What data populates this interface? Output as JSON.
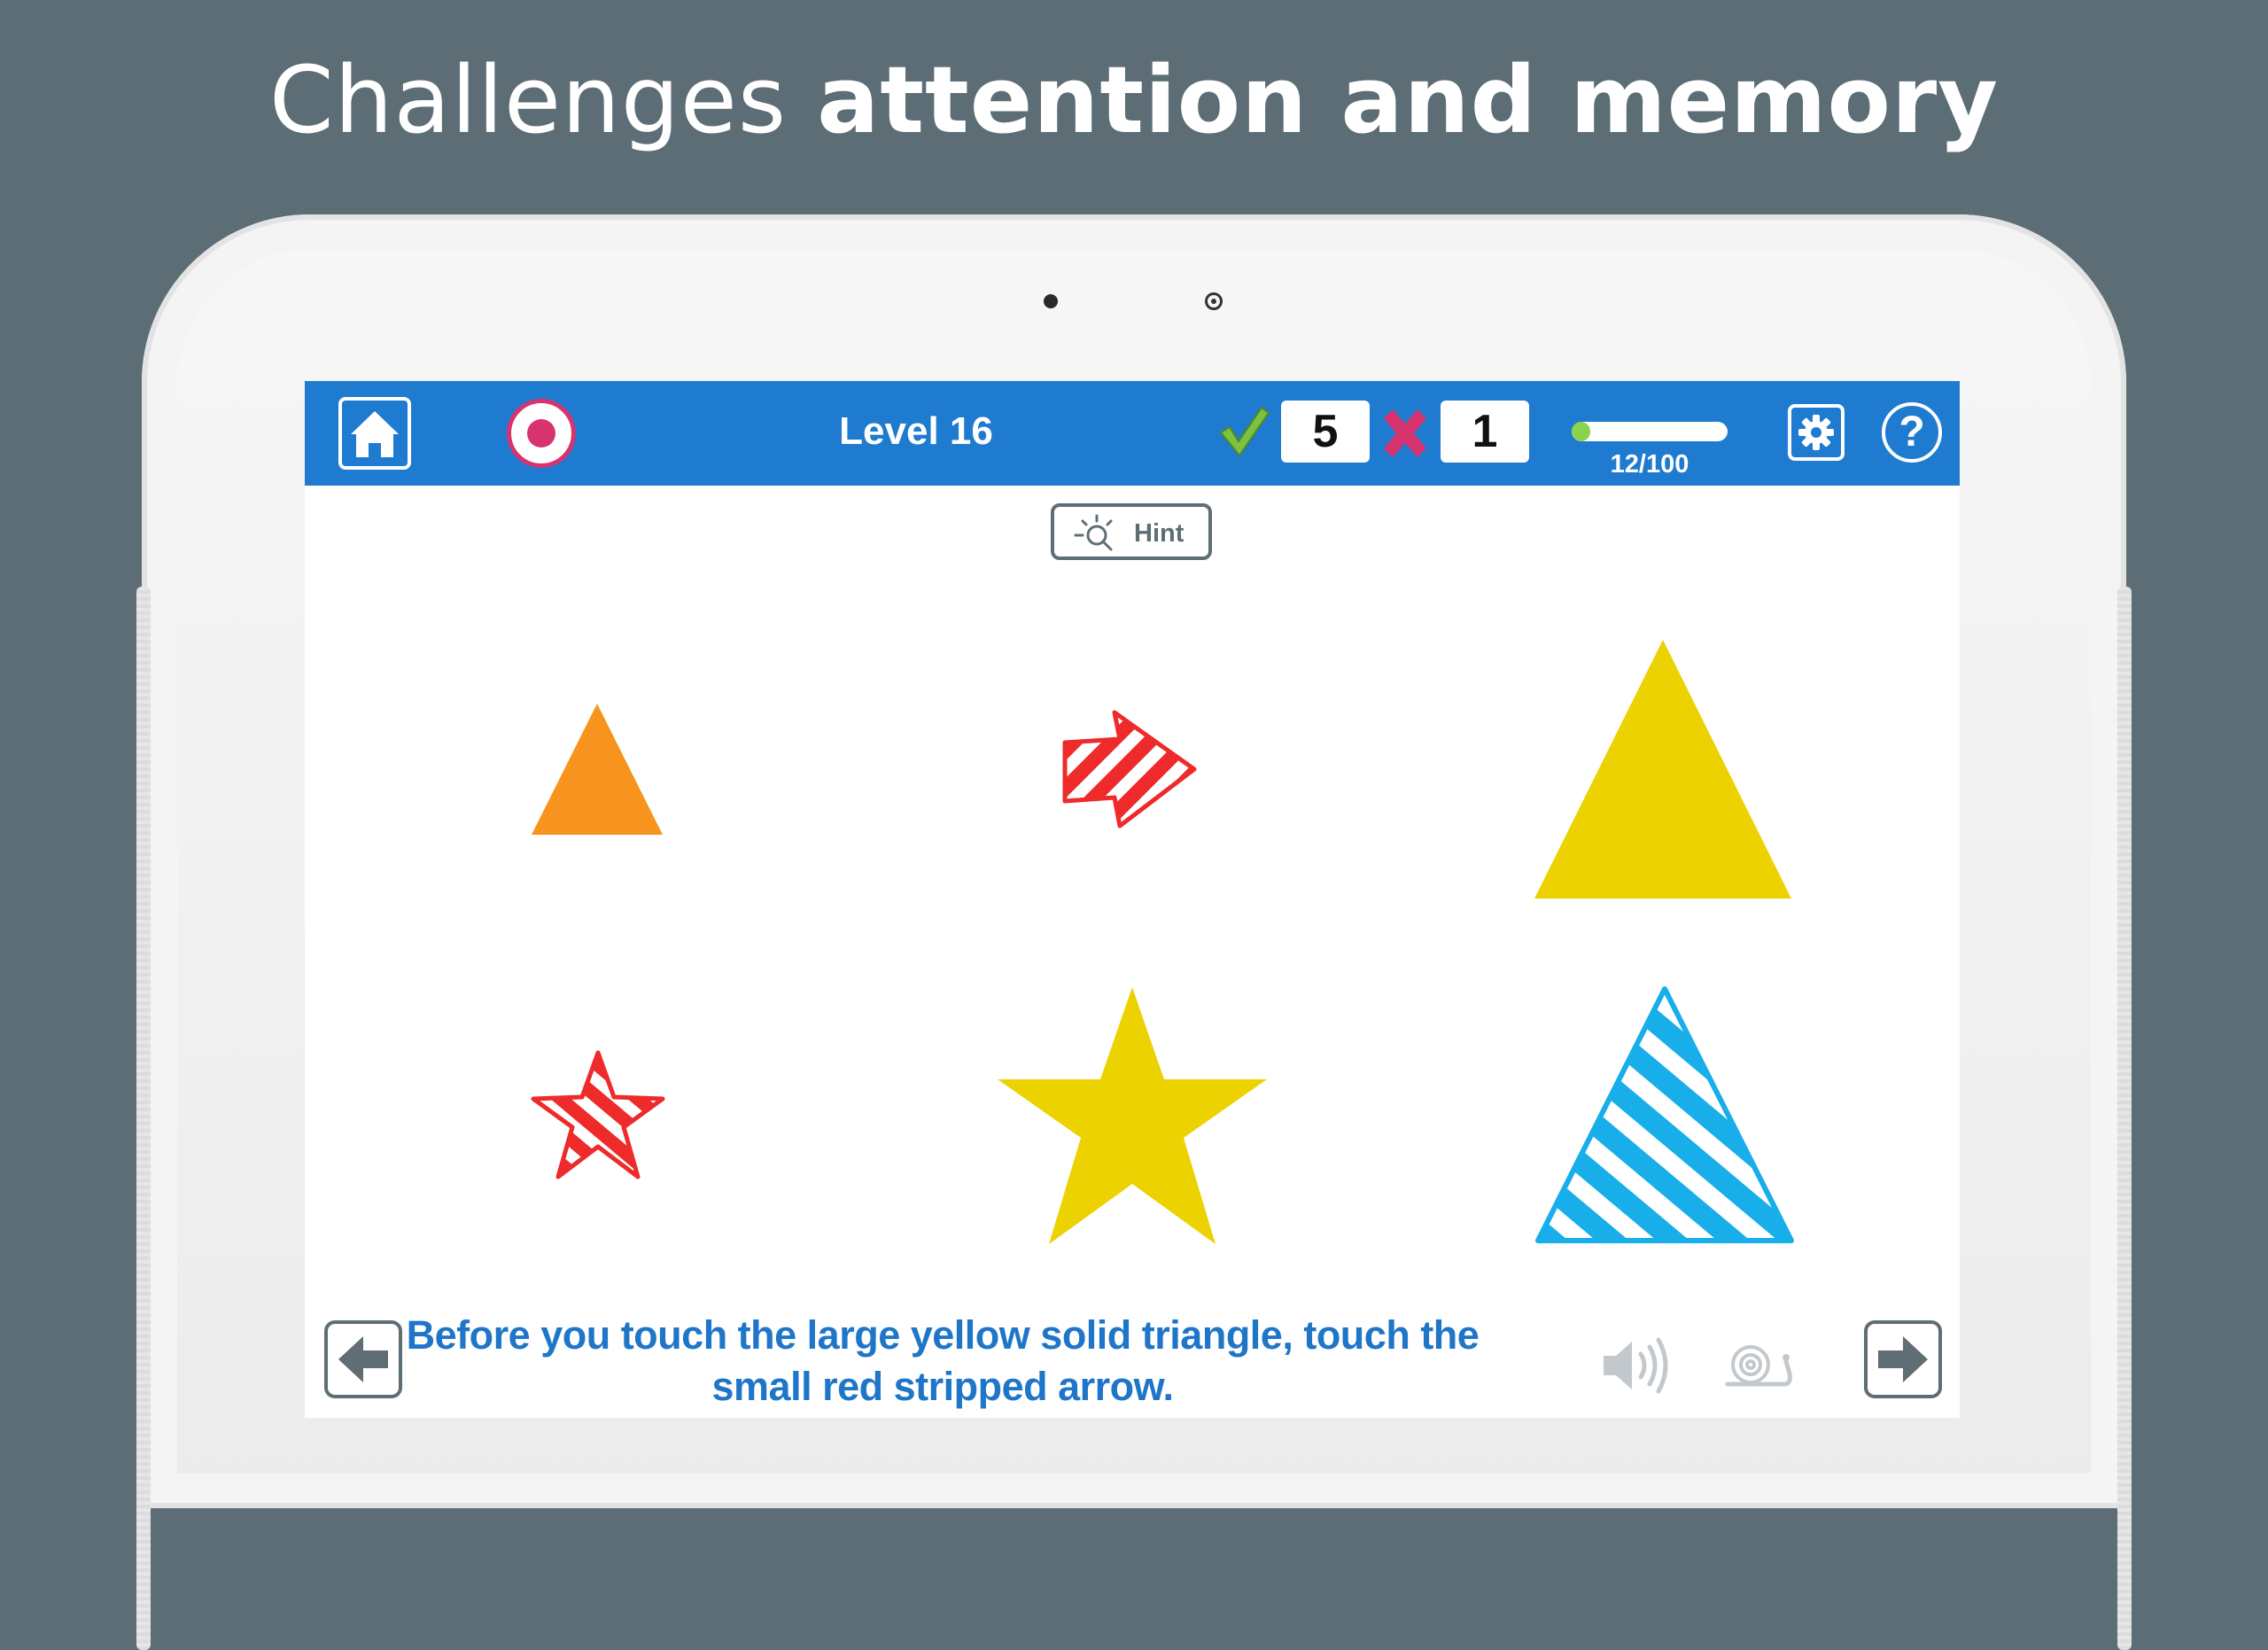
{
  "headline": {
    "light": "Challenges ",
    "bold": "attention and memory"
  },
  "topbar": {
    "level": "Level 16",
    "correct_count": "5",
    "wrong_count": "1",
    "progress_label": "12/100",
    "progress_fraction": 0.12,
    "accent": "#1f7bcf"
  },
  "hint": {
    "label": "Hint"
  },
  "shapes": [
    {
      "name": "small-orange-solid-triangle",
      "color": "#f7941d",
      "pattern": "solid"
    },
    {
      "name": "small-red-striped-arrow",
      "color": "#ee2a2a",
      "pattern": "striped"
    },
    {
      "name": "large-yellow-solid-triangle",
      "color": "#ecd200",
      "pattern": "solid"
    },
    {
      "name": "small-red-striped-star",
      "color": "#ee2a2a",
      "pattern": "striped"
    },
    {
      "name": "large-yellow-solid-star",
      "color": "#ecd200",
      "pattern": "solid"
    },
    {
      "name": "large-blue-striped-triangle",
      "color": "#18aeea",
      "pattern": "striped"
    }
  ],
  "instruction": "Before you touch the large yellow solid triangle, touch the small red stripped arrow.",
  "icons": [
    "home-icon",
    "record-icon",
    "check-icon",
    "cross-icon",
    "gear-icon",
    "help-icon",
    "hint-icon",
    "back-arrow-icon",
    "speaker-icon",
    "snail-icon",
    "forward-arrow-icon"
  ]
}
